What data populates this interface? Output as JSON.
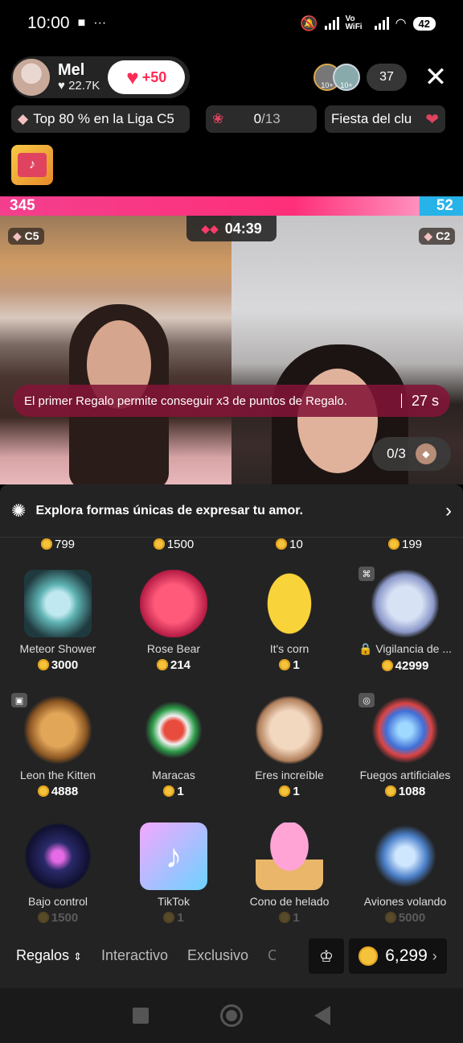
{
  "status": {
    "time": "10:00",
    "ellipsis": "···",
    "volte": "Vo WiFi",
    "battery": "42"
  },
  "host": {
    "name": "Mel",
    "likes": "22.7K",
    "like_button": "+50",
    "viewer_badge_a": "10+",
    "viewer_badge_b": "10+",
    "viewer_count": "37"
  },
  "info": {
    "league": "Top 80 % en la Liga C5",
    "roses_count": "0",
    "roses_total": "/13",
    "fiesta": "Fiesta del clu"
  },
  "battle": {
    "left_score": "345",
    "right_score": "52",
    "timer": "04:39",
    "left_tier": "C5",
    "right_tier": "C2"
  },
  "banner": {
    "text": "El primer Regalo permite conseguir x3 de puntos de Regalo.",
    "seconds": "27 s"
  },
  "gift_progress": "0/3",
  "panel": {
    "explore_text": "Explora formas únicas de expresar tu amor.",
    "prev_prices": [
      "799",
      "1500",
      "10",
      "199"
    ],
    "gifts": [
      {
        "name": "Meteor Shower",
        "price": "3000",
        "icon": "meteor-shower-icon"
      },
      {
        "name": "Rose Bear",
        "price": "214",
        "icon": "rose-bear-icon"
      },
      {
        "name": "It's corn",
        "price": "1",
        "icon": "corn-icon"
      },
      {
        "name": "Vigilancia de ...",
        "price": "42999",
        "icon": "guardian-icon"
      },
      {
        "name": "Leon the Kitten",
        "price": "4888",
        "icon": "lion-kitten-icon"
      },
      {
        "name": "Maracas",
        "price": "1",
        "icon": "maracas-icon"
      },
      {
        "name": "Eres increíble",
        "price": "1",
        "icon": "cat-thumbs-up-icon"
      },
      {
        "name": "Fuegos artificiales",
        "price": "1088",
        "icon": "fireworks-icon"
      },
      {
        "name": "Bajo control",
        "price": "1500",
        "icon": "vinyl-record-icon"
      },
      {
        "name": "TikTok",
        "price": "1",
        "icon": "tiktok-logo-icon"
      },
      {
        "name": "Cono de helado",
        "price": "1",
        "icon": "ice-cream-cone-icon"
      },
      {
        "name": "Aviones volando",
        "price": "5000",
        "icon": "jets-flying-icon"
      }
    ]
  },
  "tabs": {
    "regalos": "Regalos",
    "interactivo": "Interactivo",
    "exclusivo": "Exclusivo",
    "cut": "C"
  },
  "balance": "6,299",
  "colors": {
    "accent_pink": "#fe2c55",
    "battle_pink": "#ff2f79",
    "battle_blue": "#27b2e8",
    "coin": "#f5c33b"
  }
}
